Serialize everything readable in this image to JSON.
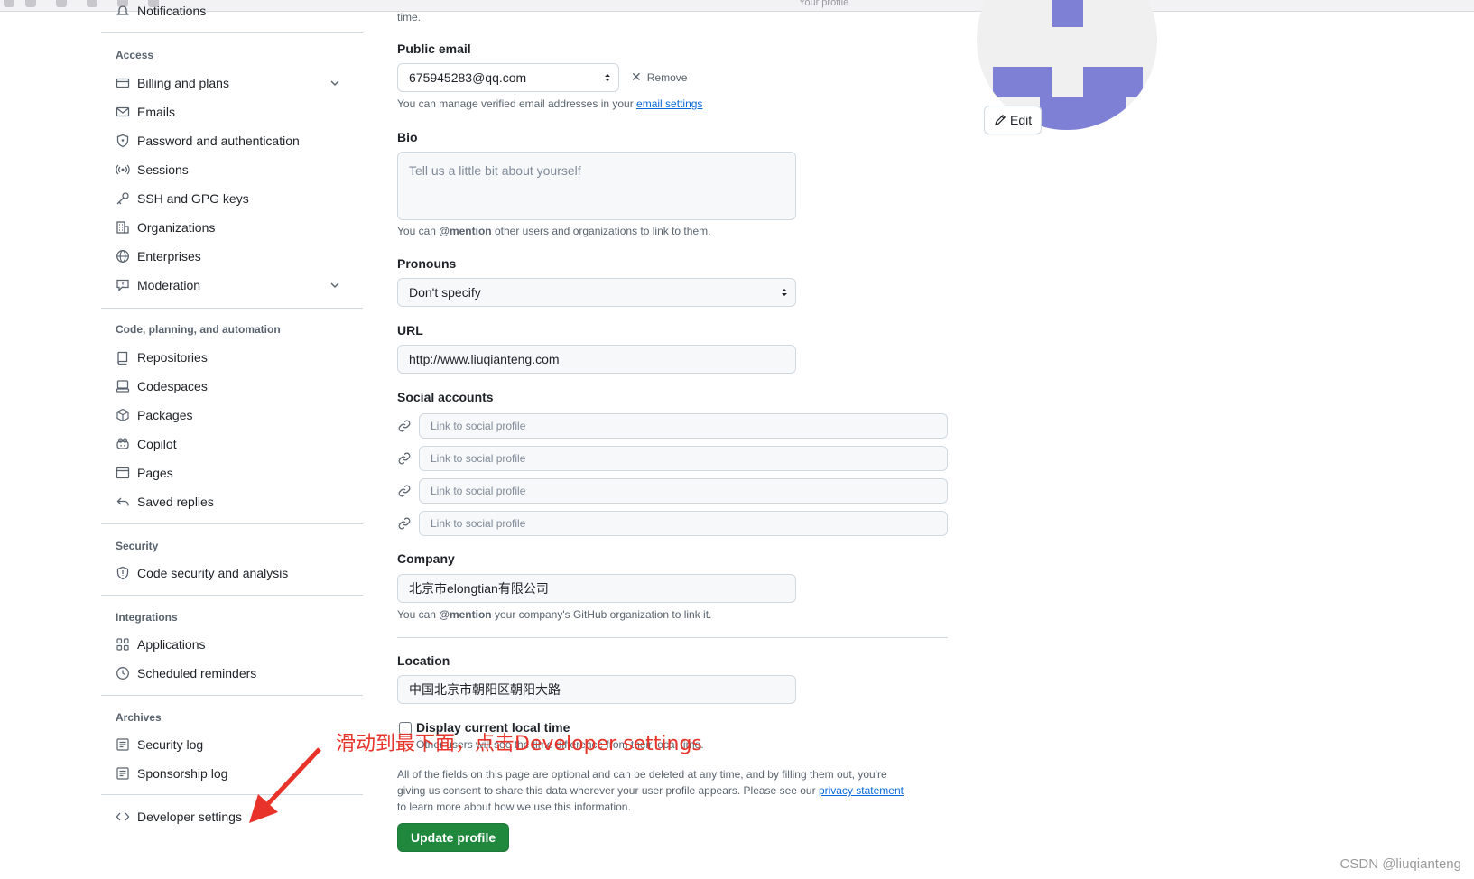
{
  "topbar": {
    "title": "Your profile"
  },
  "sidebar": {
    "top_item": "Notifications",
    "access_heading": "Access",
    "access_items": [
      "Billing and plans",
      "Emails",
      "Password and authentication",
      "Sessions",
      "SSH and GPG keys",
      "Organizations",
      "Enterprises",
      "Moderation"
    ],
    "code_heading": "Code, planning, and automation",
    "code_items": [
      "Repositories",
      "Codespaces",
      "Packages",
      "Copilot",
      "Pages",
      "Saved replies"
    ],
    "security_heading": "Security",
    "security_items": [
      "Code security and analysis"
    ],
    "integrations_heading": "Integrations",
    "integrations_items": [
      "Applications",
      "Scheduled reminders"
    ],
    "archives_heading": "Archives",
    "archives_items": [
      "Security log",
      "Sponsorship log"
    ],
    "developer_settings": "Developer settings"
  },
  "form": {
    "top_note": "time.",
    "public_email_label": "Public email",
    "public_email_value": "675945283@qq.com",
    "remove_label": "Remove",
    "email_note_prefix": "You can manage verified email addresses in your ",
    "email_note_link": "email settings",
    "bio_label": "Bio",
    "bio_placeholder": "Tell us a little bit about yourself",
    "bio_note_prefix": "You can ",
    "bio_note_mention": "@mention",
    "bio_note_suffix": " other users and organizations to link to them.",
    "pronouns_label": "Pronouns",
    "pronouns_value": "Don't specify",
    "url_label": "URL",
    "url_value": "http://www.liuqianteng.com",
    "social_label": "Social accounts",
    "social_placeholder": "Link to social profile",
    "company_label": "Company",
    "company_value": "北京市elongtian有限公司",
    "company_note_prefix": "You can ",
    "company_note_mention": "@mention",
    "company_note_suffix": " your company's GitHub organization to link it.",
    "location_label": "Location",
    "location_value": "中国北京市朝阳区朝阳大路",
    "local_time_label": "Display current local time",
    "local_time_note": "Other users will see the time difference from their local time.",
    "privacy_line1": "All of the fields on this page are optional and can be deleted at any time, and by filling them out, you're",
    "privacy_line2_prefix": "giving us consent to share this data wherever your user profile appears. Please see our ",
    "privacy_link": "privacy statement",
    "privacy_line3": "to learn more about how we use this information.",
    "update_button": "Update profile"
  },
  "avatar": {
    "edit_label": "Edit",
    "color": "#7e80d6"
  },
  "annotation": {
    "text": "滑动到最下面，点击Developer settings",
    "color": "#e8332a"
  },
  "watermark": "CSDN @liuqianteng"
}
